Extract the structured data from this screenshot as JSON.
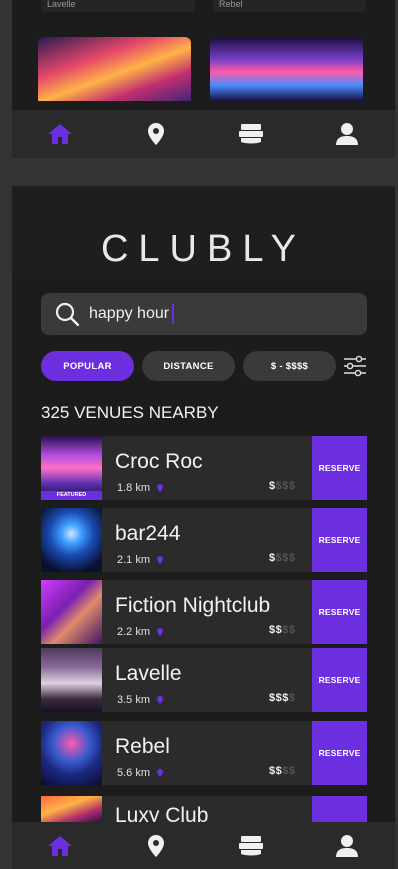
{
  "top_screen": {
    "cut_labels": [
      "Lavelle",
      "Rebel"
    ]
  },
  "nav": {
    "items": [
      {
        "icon": "home-icon",
        "active": true
      },
      {
        "icon": "location-pin-icon",
        "active": false
      },
      {
        "icon": "tickets-icon",
        "active": false
      },
      {
        "icon": "profile-icon",
        "active": false
      }
    ]
  },
  "app": {
    "brand": "CLUBLY"
  },
  "search": {
    "value": "happy hour"
  },
  "filters": {
    "popular": "POPULAR",
    "distance": "DISTANCE",
    "price": "$ - $$$$"
  },
  "results": {
    "count_label": "325 VENUES NEARBY"
  },
  "venues": [
    {
      "name": "Croc Roc",
      "distance": "1.8  km",
      "price_on": "$",
      "price_off": "$$$",
      "featured": "FEATURED",
      "reserve": "RESERVE"
    },
    {
      "name": "bar244",
      "distance": "2.1 km",
      "price_on": "$",
      "price_off": "$$$",
      "reserve": "RESERVE"
    },
    {
      "name": "Fiction Nightclub",
      "distance": "2.2 km",
      "price_on": "$$",
      "price_off": "$$",
      "reserve": "RESERVE"
    },
    {
      "name": "Lavelle",
      "distance": "3.5 km",
      "price_on": "$$$",
      "price_off": "$",
      "reserve": "RESERVE"
    },
    {
      "name": "Rebel",
      "distance": "5.6 km",
      "price_on": "$$",
      "price_off": "$$",
      "reserve": "RESERVE"
    },
    {
      "name": "Luxy Club"
    }
  ],
  "colors": {
    "accent": "#6b2fe0",
    "background": "#1c1c1c",
    "card": "#2b2b2b"
  }
}
